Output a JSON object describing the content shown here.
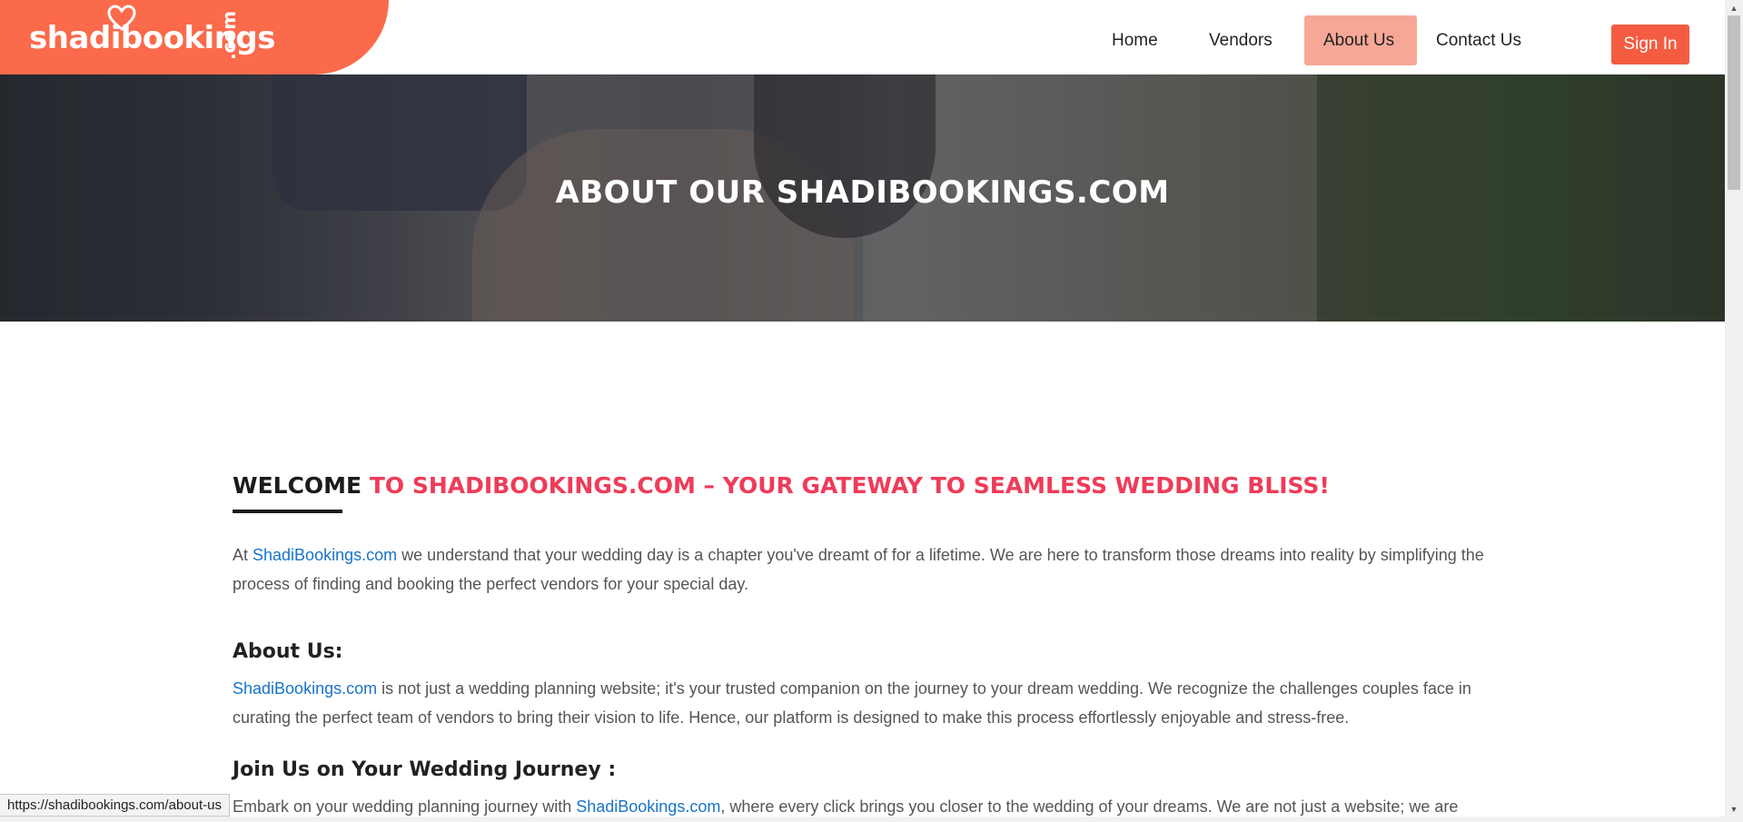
{
  "brand": {
    "name": "shadibookings",
    "suffix": ".com",
    "color": "#fb6a4b"
  },
  "nav": {
    "items": [
      {
        "label": "Home"
      },
      {
        "label": "Vendors"
      },
      {
        "label": "About Us",
        "active": true
      },
      {
        "label": "Contact Us"
      }
    ],
    "signin_label": "Sign In"
  },
  "hero": {
    "title": "ABOUT OUR SHADIBOOKINGS.COM"
  },
  "welcome": {
    "lead": "WELCOME",
    "rest": " TO SHADIBOOKINGS.COM – YOUR GATEWAY TO SEAMLESS WEDDING BLISS!"
  },
  "intro": {
    "prefix": "At ",
    "link": "ShadiBookings.com",
    "text": " we understand that your wedding day is a chapter you've dreamt of for a lifetime. We are here to transform those dreams into reality by simplifying the process of finding and booking the perfect vendors for your special day."
  },
  "about": {
    "heading": "About Us:",
    "link": "ShadiBookings.com",
    "text": " is not just a wedding planning website; it's your trusted companion on the journey to your dream wedding. We recognize the challenges couples face in curating the perfect team of vendors to bring their vision to life. Hence, our platform is designed to make this process effortlessly enjoyable and stress-free."
  },
  "join": {
    "heading": "Join Us on Your Wedding Journey :",
    "prefix": "Embark on your wedding planning journey with ",
    "link": "ShadiBookings.com",
    "text": ", where every click brings you closer to the wedding of your dreams. We are not just a website; we are"
  },
  "status_url": "https://shadibookings.com/about-us",
  "colors": {
    "accent_red": "#ee3c59",
    "link_blue": "#1a73c8",
    "signin": "#f45c41",
    "nav_active": "#f7a796"
  }
}
